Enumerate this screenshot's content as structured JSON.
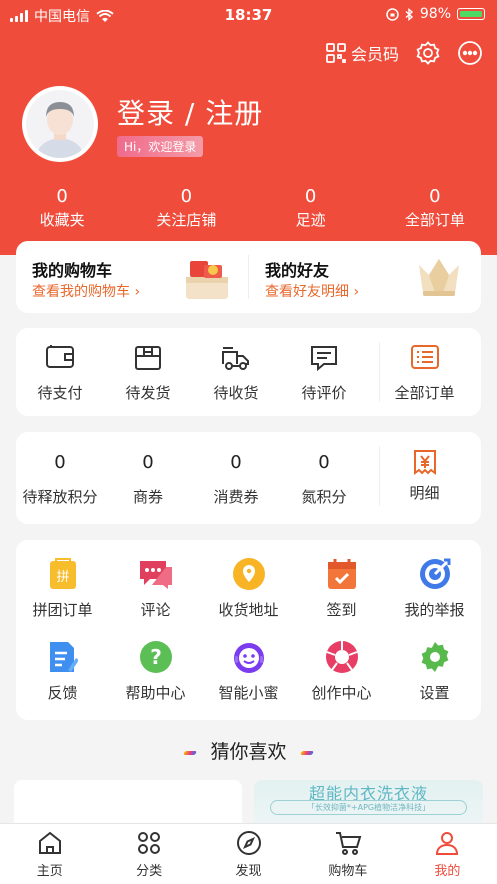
{
  "status_bar": {
    "carrier": "中国电信",
    "time": "18:37",
    "battery": "98%"
  },
  "header": {
    "member_code_label": "会员码",
    "login_title": "登录 / 注册",
    "hi_badge": "Hi，欢迎登录"
  },
  "stats": [
    {
      "num": "0",
      "label": "收藏夹"
    },
    {
      "num": "0",
      "label": "关注店铺"
    },
    {
      "num": "0",
      "label": "足迹"
    },
    {
      "num": "0",
      "label": "全部订单"
    }
  ],
  "cart_card": {
    "cart_title": "我的购物车",
    "cart_sub": "查看我的购物车 ›",
    "friends_title": "我的好友",
    "friends_sub": "查看好友明细 ›"
  },
  "orders": [
    {
      "label": "待支付",
      "icon": "wallet-icon"
    },
    {
      "label": "待发货",
      "icon": "box-icon"
    },
    {
      "label": "待收货",
      "icon": "truck-icon"
    },
    {
      "label": "待评价",
      "icon": "comment-icon"
    },
    {
      "label": "全部订单",
      "icon": "order-list-icon"
    }
  ],
  "points": [
    {
      "num": "0",
      "label": "待释放积分"
    },
    {
      "num": "0",
      "label": "商券"
    },
    {
      "num": "0",
      "label": "消费券"
    },
    {
      "num": "0",
      "label": "氮积分"
    },
    {
      "label": "明细",
      "icon": "yen-detail-icon"
    }
  ],
  "tools": [
    {
      "label": "拼团订单",
      "icon": "group-order-icon"
    },
    {
      "label": "评论",
      "icon": "chat-icon"
    },
    {
      "label": "收货地址",
      "icon": "location-icon"
    },
    {
      "label": "签到",
      "icon": "calendar-check-icon"
    },
    {
      "label": "我的举报",
      "icon": "target-icon"
    },
    {
      "label": "反馈",
      "icon": "feedback-icon"
    },
    {
      "label": "帮助中心",
      "icon": "help-icon"
    },
    {
      "label": "智能小蜜",
      "icon": "smile-bot-icon"
    },
    {
      "label": "创作中心",
      "icon": "aperture-icon"
    },
    {
      "label": "设置",
      "icon": "gear-icon"
    }
  ],
  "guess_title": "猜你喜欢",
  "product_banner": {
    "title": "超能内衣洗衣液",
    "sub": "「长效抑菌*+APG植物洁净科技」"
  },
  "tabbar": [
    {
      "label": "主页",
      "icon": "home-icon"
    },
    {
      "label": "分类",
      "icon": "category-icon"
    },
    {
      "label": "发现",
      "icon": "compass-icon"
    },
    {
      "label": "购物车",
      "icon": "cart-icon"
    },
    {
      "label": "我的",
      "icon": "user-icon",
      "active": true
    }
  ],
  "colors": {
    "brand": "#f04c3b",
    "accent_orange": "#e8682c"
  }
}
